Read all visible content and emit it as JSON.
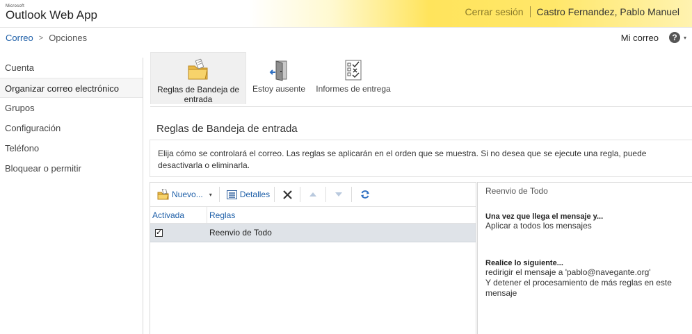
{
  "app": {
    "brand_small": "Microsoft",
    "brand": "Outlook Web App"
  },
  "header": {
    "signout": "Cerrar sesión",
    "username": "Castro Fernandez, Pablo Manuel"
  },
  "breadcrumb": {
    "root": "Correo",
    "separator": ">",
    "current": "Opciones"
  },
  "topnav": {
    "mymail": "Mi correo",
    "help": "?",
    "help_arrow": "▾"
  },
  "sidebar": {
    "items": [
      {
        "label": "Cuenta"
      },
      {
        "label": "Organizar correo electrónico",
        "active": true
      },
      {
        "label": "Grupos"
      },
      {
        "label": "Configuración"
      },
      {
        "label": "Teléfono"
      },
      {
        "label": "Bloquear o permitir"
      }
    ]
  },
  "tabs": [
    {
      "label": "Reglas de Bandeja de entrada",
      "icon": "folder-rules-icon",
      "active": true
    },
    {
      "label": "Estoy ausente",
      "icon": "out-of-office-icon"
    },
    {
      "label": "Informes de entrega",
      "icon": "delivery-report-icon"
    }
  ],
  "section": {
    "title": "Reglas de Bandeja de entrada",
    "description": "Elija cómo se controlará el correo. Las reglas se aplicarán en el orden que se muestra. Si no desea que se ejecute una regla, puede desactivarla o eliminarla."
  },
  "toolbar": {
    "new_label": "Nuevo...",
    "new_arrow": "▾",
    "details_label": "Detalles",
    "icons": [
      "new-rule-icon",
      "details-icon",
      "delete-icon",
      "move-up-icon",
      "move-down-icon",
      "refresh-icon"
    ]
  },
  "table": {
    "columns": [
      "Activada",
      "Reglas"
    ],
    "rows": [
      {
        "enabled": true,
        "name": "Reenvio de Todo"
      }
    ]
  },
  "detail": {
    "title": "Reenvio de Todo",
    "condition_heading": "Una vez que llega el mensaje y...",
    "condition": "Aplicar a todos los mensajes",
    "action_heading": "Realice lo siguiente...",
    "action_line1": "redirigir el mensaje a 'pablo@navegante.org'",
    "action_line2": "Y detener el procesamiento de más reglas en este",
    "action_line3": "mensaje"
  },
  "colors": {
    "link": "#1e5fa8",
    "banner_accent": "#ffe45c",
    "selected_row": "#dfe3e8",
    "refresh_icon": "#2e6fc2"
  }
}
